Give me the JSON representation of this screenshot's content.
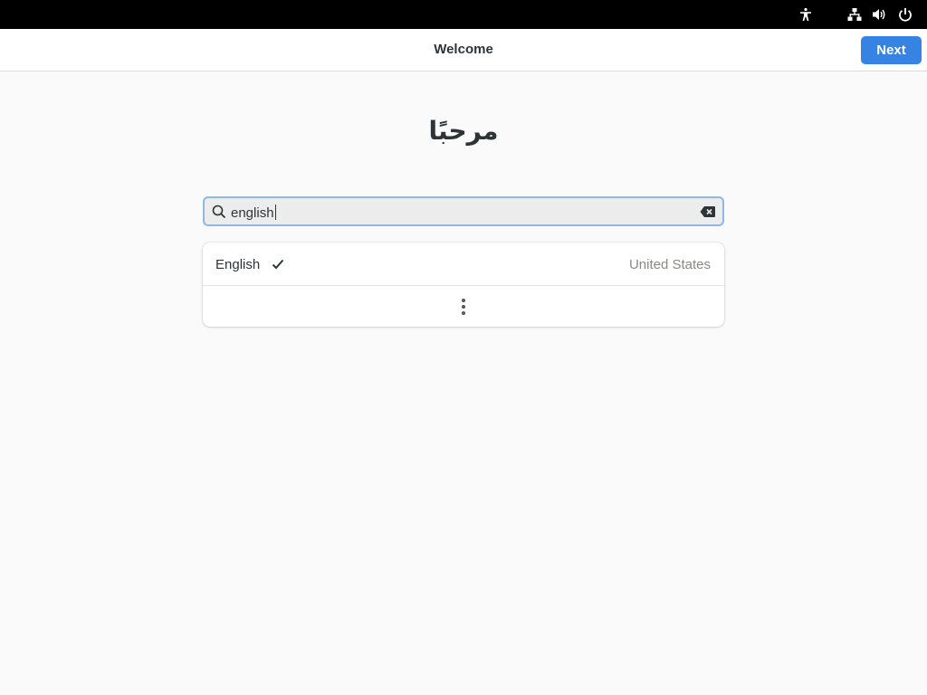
{
  "topbar": {
    "icons": [
      "accessibility-icon",
      "network-wired-icon",
      "volume-icon",
      "power-icon"
    ]
  },
  "header": {
    "title": "Welcome",
    "next_label": "Next"
  },
  "welcome": {
    "heading": "مرحبًا"
  },
  "search": {
    "value": "english"
  },
  "languages": {
    "items": [
      {
        "name": "English",
        "region": "United States",
        "selected": true
      }
    ],
    "more_icon": "view-more-icon"
  },
  "colors": {
    "accent": "#3584e4",
    "topbar": "#000000",
    "background": "#fafafa"
  }
}
